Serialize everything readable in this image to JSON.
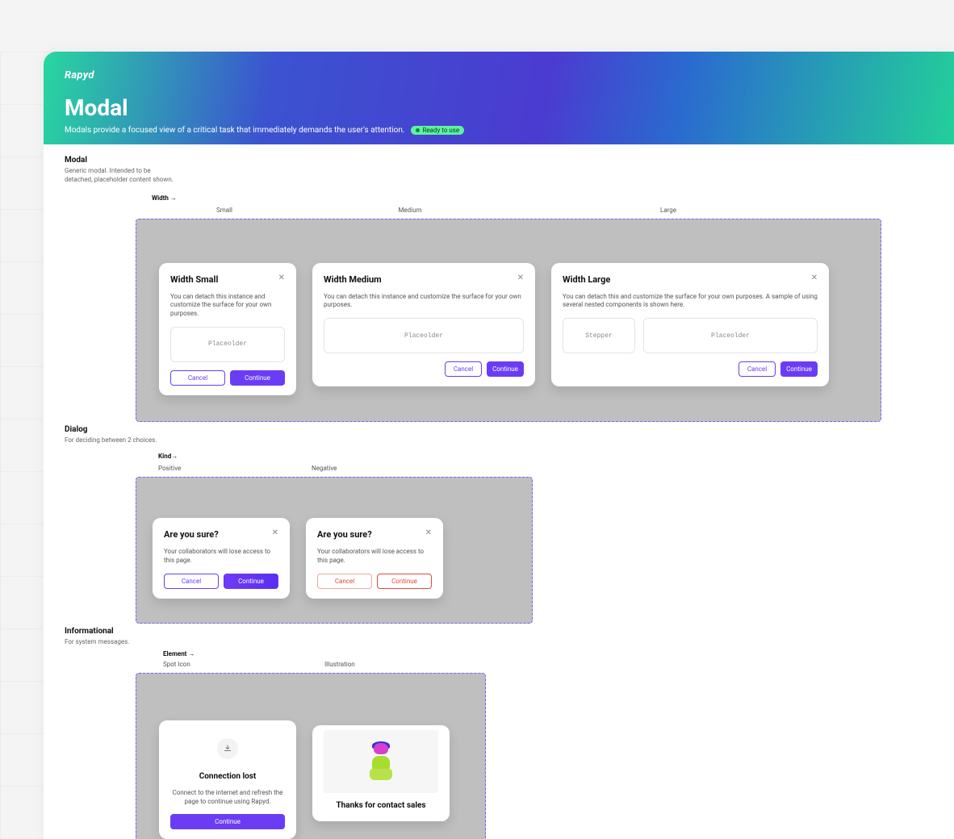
{
  "hero": {
    "logo": "Rapyd",
    "title": "Modal",
    "subtitle": "Modals provide a focused view of a critical task that immediately demands the user's attention.",
    "badge": "Ready to use"
  },
  "sections": {
    "modal": {
      "heading": "Modal",
      "desc": "Generic modal. Intended to be detached, placeholder content shown.",
      "axis": "Width →",
      "cols": [
        "Small",
        "Medium",
        "Large"
      ],
      "small": {
        "title": "Width Small",
        "desc": "You can detach this instance and customize the surface for your own purposes.",
        "slot": "Placeolder",
        "cancel": "Cancel",
        "continue": "Continue"
      },
      "medium": {
        "title": "Width Medium",
        "desc": "You can detach this instance and customize the surface for your own purposes.",
        "slot": "Placeolder",
        "cancel": "Cancel",
        "continue": "Continue"
      },
      "large": {
        "title": "Width Large",
        "desc": "You can detach this and customize the surface for your own purposes. A sample of using several nested components is shown here.",
        "slot1": "Stepper",
        "slot2": "Placeolder",
        "cancel": "Cancel",
        "continue": "Continue"
      }
    },
    "dialog": {
      "heading": "Dialog",
      "desc": "For deciding between 2 choices.",
      "axis": "Kind→",
      "cols": [
        "Positive",
        "Negative"
      ],
      "positive": {
        "title": "Are you sure?",
        "desc": "Your collaborators will lose access to this page.",
        "cancel": "Cancel",
        "continue": "Continue"
      },
      "negative": {
        "title": "Are you sure?",
        "desc": "Your collaborators will lose access to this page.",
        "cancel": "Cancel",
        "continue": "Continue"
      }
    },
    "info": {
      "heading": "Informational",
      "desc": "For system messages.",
      "axis": "Element →",
      "cols": [
        "Spot Icon",
        "Illustration"
      ],
      "spot": {
        "title": "Connection lost",
        "desc": "Connect to the internet and refresh the page to continue using Rapyd.",
        "continue": "Continue"
      },
      "illus": {
        "title": "Thanks for contact sales"
      }
    }
  }
}
